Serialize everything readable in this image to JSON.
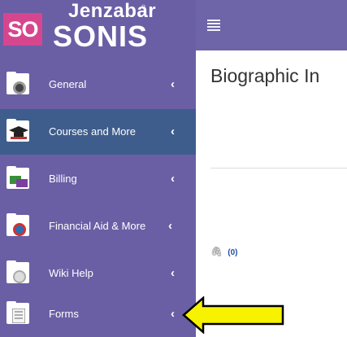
{
  "brand": {
    "badge": "SO",
    "name_small": "Jenzabar",
    "reg_mark": "®",
    "name_big": "SONIS"
  },
  "sidebar": {
    "items": [
      {
        "label": "General",
        "chevron": "‹",
        "icon": "general-icon",
        "active": false
      },
      {
        "label": "Courses and More",
        "chevron": "‹",
        "icon": "graduation-cap-icon",
        "active": true
      },
      {
        "label": "Billing",
        "chevron": "‹",
        "icon": "billing-icon",
        "active": false
      },
      {
        "label": "Financial Aid & More",
        "chevron": "‹",
        "icon": "financial-aid-icon",
        "active": false
      },
      {
        "label": "Wiki Help",
        "chevron": "‹",
        "icon": "wiki-icon",
        "active": false
      },
      {
        "label": "Forms",
        "chevron": "‹",
        "icon": "forms-icon",
        "active": false
      }
    ]
  },
  "main": {
    "title": "Biographic In",
    "attachment_count": "(0)"
  },
  "colors": {
    "sidebar": "#6a5fa5",
    "active_item": "#3e5d8c",
    "badge": "#d5468f",
    "arrow": "#f7f200"
  }
}
